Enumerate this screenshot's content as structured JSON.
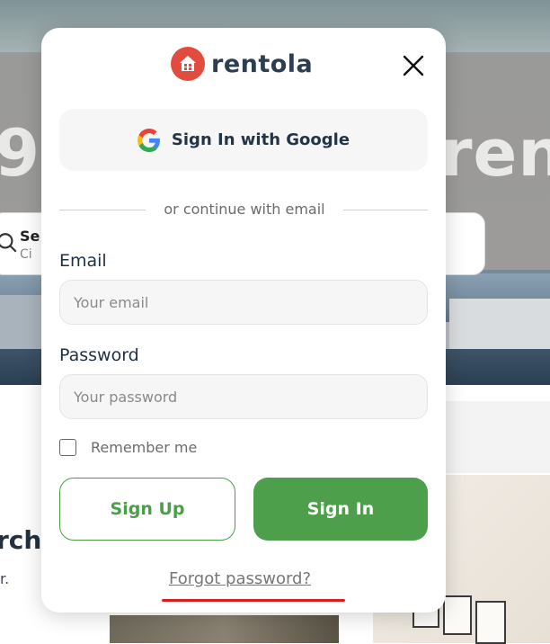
{
  "background": {
    "hero_text_left": "9",
    "hero_text_right": "rent",
    "search_title": "Se",
    "search_subtitle": "Ci",
    "section_heading": "rch",
    "section_subtext": "r."
  },
  "modal": {
    "brand": "rentola",
    "google_button": "Sign In with Google",
    "divider_text": "or continue with email",
    "email_label": "Email",
    "email_placeholder": "Your email",
    "email_value": "",
    "password_label": "Password",
    "password_placeholder": "Your password",
    "password_value": "",
    "remember_label": "Remember me",
    "remember_checked": false,
    "signup_button": "Sign Up",
    "signin_button": "Sign In",
    "forgot_link": "Forgot password?"
  },
  "colors": {
    "brand_red": "#e24c3f",
    "primary_green": "#4e9f4b",
    "text_dark": "#243447",
    "annotation_red": "#d62020"
  },
  "icons": [
    "house-logo-icon",
    "close-icon",
    "google-icon",
    "search-icon"
  ]
}
